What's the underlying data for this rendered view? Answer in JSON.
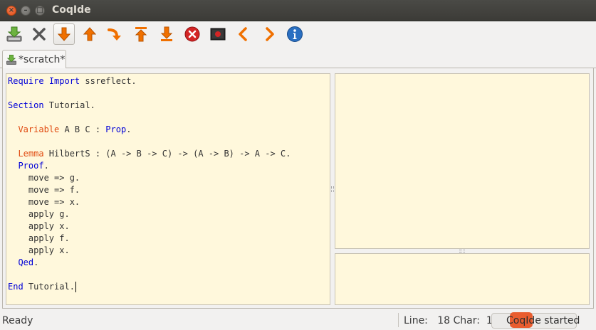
{
  "window": {
    "title": "CoqIde"
  },
  "titlebar": {
    "close_glyph": "×",
    "min_glyph": "–",
    "max_glyph": "□"
  },
  "toolbar": {
    "icons": [
      "save-icon",
      "close-icon",
      "forward-one-icon",
      "backward-one-icon",
      "go-to-cursor-icon",
      "go-to-start-icon",
      "go-to-end-icon",
      "interrupt-icon",
      "restart-icon",
      "previous-icon",
      "next-icon",
      "about-icon"
    ],
    "colors": {
      "orange": "#f07000",
      "red": "#d42525",
      "blue": "#2a6fc1",
      "grey": "#555555"
    }
  },
  "tab": {
    "label": "*scratch*"
  },
  "editor": {
    "lines": [
      {
        "parts": [
          {
            "t": "Require",
            "c": "kw"
          },
          {
            "t": " "
          },
          {
            "t": "Import",
            "c": "kw"
          },
          {
            "t": " ssreflect."
          }
        ]
      },
      {
        "parts": []
      },
      {
        "parts": [
          {
            "t": "Section",
            "c": "kw"
          },
          {
            "t": " Tutorial."
          }
        ]
      },
      {
        "parts": []
      },
      {
        "parts": [
          {
            "t": "  "
          },
          {
            "t": "Variable",
            "c": "kw2"
          },
          {
            "t": " A B C : "
          },
          {
            "t": "Prop",
            "c": "kw"
          },
          {
            "t": "."
          }
        ]
      },
      {
        "parts": []
      },
      {
        "parts": [
          {
            "t": "  "
          },
          {
            "t": "Lemma",
            "c": "kw2"
          },
          {
            "t": " HilbertS : (A -> B -> C) -> (A -> B) -> A -> C."
          }
        ]
      },
      {
        "parts": [
          {
            "t": "  "
          },
          {
            "t": "Proof",
            "c": "kw"
          },
          {
            "t": "."
          }
        ]
      },
      {
        "parts": [
          {
            "t": "    move => g."
          }
        ]
      },
      {
        "parts": [
          {
            "t": "    move => f."
          }
        ]
      },
      {
        "parts": [
          {
            "t": "    move => x."
          }
        ]
      },
      {
        "parts": [
          {
            "t": "    apply g."
          }
        ]
      },
      {
        "parts": [
          {
            "t": "    apply x."
          }
        ]
      },
      {
        "parts": [
          {
            "t": "    apply f."
          }
        ]
      },
      {
        "parts": [
          {
            "t": "    apply x."
          }
        ]
      },
      {
        "parts": [
          {
            "t": "  "
          },
          {
            "t": "Qed",
            "c": "kw"
          },
          {
            "t": "."
          }
        ]
      },
      {
        "parts": []
      },
      {
        "parts": [
          {
            "t": "End",
            "c": "kw"
          },
          {
            "t": " Tutorial."
          }
        ],
        "cursor": true
      }
    ]
  },
  "statusbar": {
    "ready": "Ready",
    "position": "Line:   18 Char:  14",
    "message": "CoqIde started"
  }
}
